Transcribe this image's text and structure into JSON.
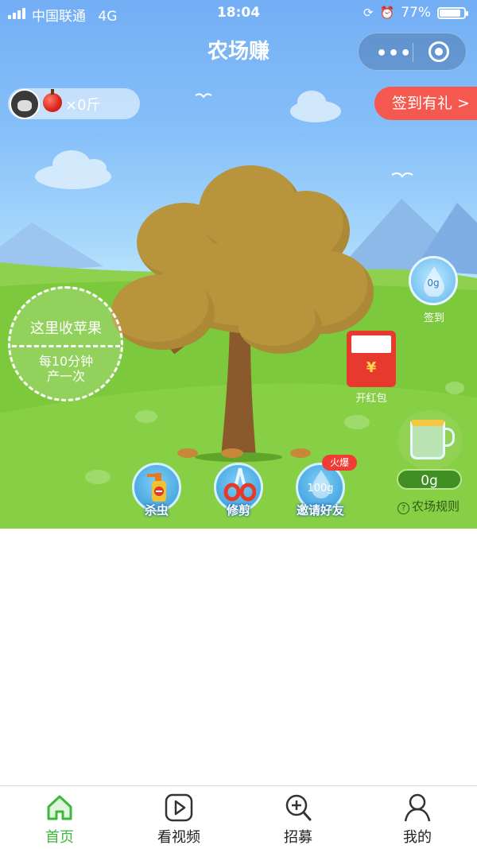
{
  "status_bar": {
    "carrier": "中国联通",
    "network": "4G",
    "time": "18:04",
    "battery": "77%"
  },
  "nav": {
    "title": "农场赚",
    "more_icon": "more-dots-icon",
    "close_icon": "target-circle-icon"
  },
  "user": {
    "apple_count": "×0斤"
  },
  "sign_in_button": "签到有礼 >",
  "harvest": {
    "line1": "这里收苹果",
    "line2": "每10分钟",
    "line3": "产一次"
  },
  "side": {
    "water_drop_amount": "0g",
    "sign_label": "签到",
    "red_packet_label": "开红包",
    "red_packet_symbol": "¥",
    "jar_amount": "0g",
    "rules_label": "农场规则"
  },
  "tools": [
    {
      "label": "杀虫"
    },
    {
      "label": "修剪"
    },
    {
      "label": "邀请好友",
      "badge": "火爆",
      "amount": "100g"
    }
  ],
  "tabs": [
    {
      "label": "首页",
      "icon": "home-icon",
      "active": true
    },
    {
      "label": "看视频",
      "icon": "play-video-icon",
      "active": false
    },
    {
      "label": "招募",
      "icon": "search-plus-icon",
      "active": false
    },
    {
      "label": "我的",
      "icon": "user-icon",
      "active": false
    }
  ],
  "colors": {
    "accent_green": "#3db83a",
    "banner_red": "#f5584e",
    "sky_blue": "#73aef5"
  }
}
